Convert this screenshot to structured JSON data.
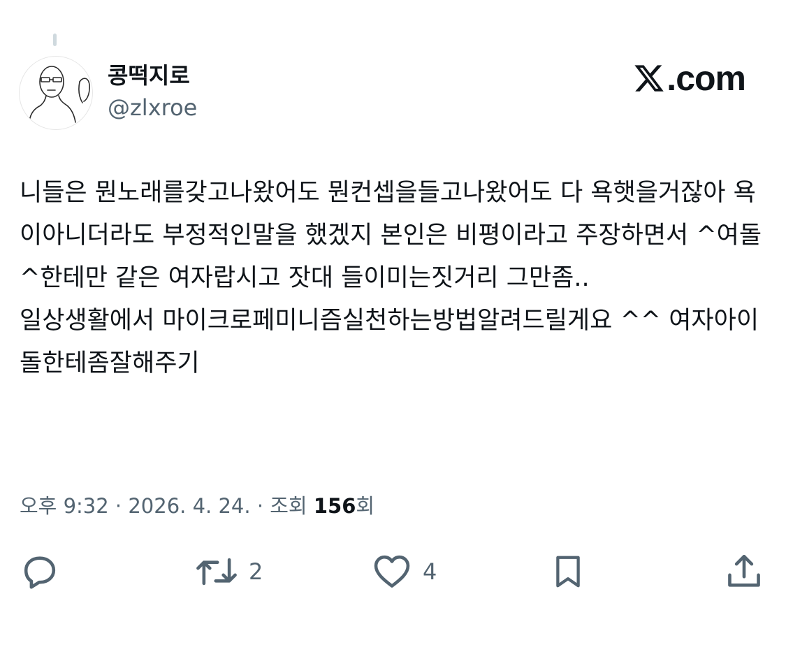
{
  "author": {
    "display_name": "콩떡지로",
    "handle": "@zlxroe"
  },
  "site": {
    "label": ".com",
    "logo_icon": "x-logo-icon"
  },
  "tweet": {
    "text": "니들은 뭔노래를갖고나왔어도 뭔컨셉을들고나왔어도 다 욕햇을거잖아 욕이아니더라도 부정적인말을 했겠지 본인은 비평이라고 주장하면서 ^여돌^한테만 같은 여자랍시고 잣대 들이미는짓거리 그만좀..\n일상생활에서 마이크로페미니즘실천하는방법알려드릴게요 ^^ 여자아이돌한테좀잘해주기"
  },
  "meta": {
    "time_date": "오후 9:32 · 2026. 4. 24. · 조회 ",
    "views_count": "156",
    "views_suffix": "회"
  },
  "actions": {
    "reply": {
      "icon": "reply-icon",
      "count": ""
    },
    "retweet": {
      "icon": "retweet-icon",
      "count": "2"
    },
    "like": {
      "icon": "heart-icon",
      "count": "4"
    },
    "bookmark": {
      "icon": "bookmark-icon",
      "count": ""
    },
    "share": {
      "icon": "share-icon",
      "count": ""
    }
  },
  "colors": {
    "text_primary": "#0f1419",
    "text_secondary": "#536471",
    "thread_line": "#cfd9de",
    "background": "#ffffff"
  }
}
